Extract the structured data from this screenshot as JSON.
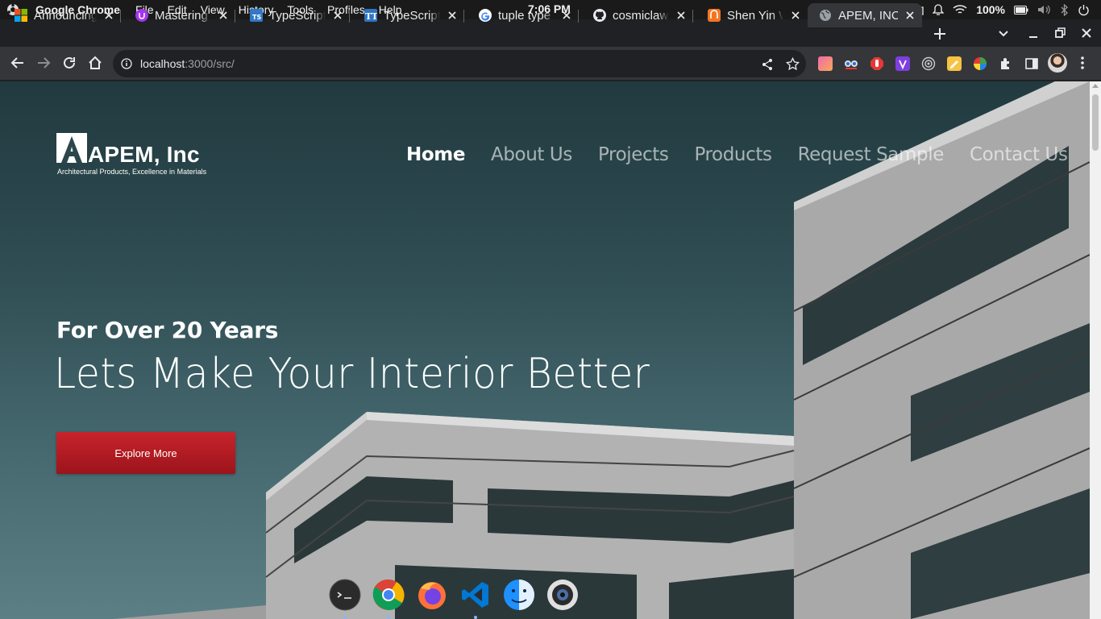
{
  "os_bar": {
    "app_name": "Google Chrome",
    "menu": [
      "File",
      "Edit",
      "View",
      "History",
      "Tools",
      "Profiles",
      "Help"
    ],
    "clock": "7:06 PM",
    "battery": "100%"
  },
  "tabs": [
    {
      "title": "Announcing TypeScript",
      "favicon": "microsoft-icon",
      "active": false
    },
    {
      "title": "Mastering TypeScript",
      "favicon": "udemy-icon",
      "active": false
    },
    {
      "title": "TypeScript: Handbook",
      "favicon": "typescript-icon",
      "active": false
    },
    {
      "title": "TypeScript / Tuple",
      "favicon": "tt-icon",
      "active": false
    },
    {
      "title": "tuple type - Google",
      "favicon": "google-icon",
      "active": false
    },
    {
      "title": "cosmiclaw/ts",
      "favicon": "github-icon",
      "active": false
    },
    {
      "title": "Shen Yin Wang",
      "favicon": "crunchyroll-icon",
      "active": false
    },
    {
      "title": "APEM, INC",
      "favicon": "globe-icon",
      "active": true
    }
  ],
  "address_bar": {
    "url_host": "localhost",
    "url_rest": ":3000/src/"
  },
  "site": {
    "brand": "APEM, Inc",
    "tagline": "Architectural Products, Excellence in Materials",
    "nav": [
      {
        "label": "Home",
        "active": true
      },
      {
        "label": "About Us",
        "active": false
      },
      {
        "label": "Projects",
        "active": false
      },
      {
        "label": "Products",
        "active": false
      },
      {
        "label": "Request Sample",
        "active": false
      },
      {
        "label": "Contact Us",
        "active": false
      }
    ],
    "hero": {
      "eyebrow": "For Over 20 Years",
      "headline": "Lets Make Your Interior Better",
      "cta": "Explore More"
    }
  },
  "dock": [
    "terminal-icon",
    "chrome-icon",
    "firefox-icon",
    "vscode-icon",
    "finder-icon",
    "camera-icon"
  ],
  "colors": {
    "accent_red": "#b01c24",
    "hero_teal": "#2f4d53",
    "chrome_dark": "#202124",
    "chrome_toolbar": "#35363a"
  }
}
